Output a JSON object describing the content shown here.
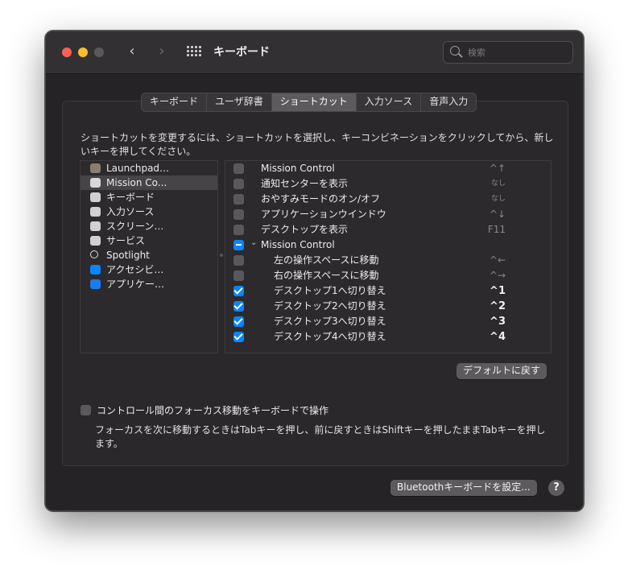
{
  "window": {
    "title": "キーボード"
  },
  "search": {
    "placeholder": "検索"
  },
  "tabs": [
    {
      "label": "キーボード",
      "active": false
    },
    {
      "label": "ユーザ辞書",
      "active": false
    },
    {
      "label": "ショートカット",
      "active": true
    },
    {
      "label": "入力ソース",
      "active": false
    },
    {
      "label": "音声入力",
      "active": false
    }
  ],
  "description": "ショートカットを変更するには、ショートカットを選択し、キーコンビネーションをクリックしてから、新しいキーを押してください。",
  "categories": [
    {
      "label": "Launchpad…",
      "icon": "launchpad-icon",
      "color": "#8a7f6e",
      "selected": false
    },
    {
      "label": "Mission Co...",
      "icon": "mission-control-icon",
      "color": "#d8d8d8",
      "selected": true
    },
    {
      "label": "キーボード",
      "icon": "keyboard-icon",
      "color": "#d0d0d0",
      "selected": false
    },
    {
      "label": "入力ソース",
      "icon": "input-source-icon",
      "color": "#d0d0d0",
      "selected": false
    },
    {
      "label": "スクリーン…",
      "icon": "screenshot-icon",
      "color": "#d0d0d0",
      "selected": false
    },
    {
      "label": "サービス",
      "icon": "gear-icon",
      "color": "#d0d0d0",
      "selected": false
    },
    {
      "label": "Spotlight",
      "icon": "spotlight-icon",
      "color": "#2c2a2d",
      "selected": false
    },
    {
      "label": "アクセシビ…",
      "icon": "accessibility-icon",
      "color": "#0a84ff",
      "selected": false
    },
    {
      "label": "アプリケー…",
      "icon": "app-store-icon",
      "color": "#1a7cf0",
      "selected": false
    }
  ],
  "shortcuts": [
    {
      "label": "Mission Control",
      "key": "^↑",
      "state": "off",
      "indent": 0,
      "key_style": "dim"
    },
    {
      "label": "通知センターを表示",
      "key": "なし",
      "state": "off",
      "indent": 0,
      "key_style": "small"
    },
    {
      "label": "おやすみモードのオン/オフ",
      "key": "なし",
      "state": "off",
      "indent": 0,
      "key_style": "small"
    },
    {
      "label": "アプリケーションウインドウ",
      "key": "^↓",
      "state": "off",
      "indent": 0,
      "key_style": "dim"
    },
    {
      "label": "デスクトップを表示",
      "key": "F11",
      "state": "off",
      "indent": 0,
      "key_style": "dim"
    },
    {
      "label": "Mission Control",
      "key": "",
      "state": "mixed",
      "indent": 0,
      "group": true,
      "key_style": "dim"
    },
    {
      "label": "左の操作スペースに移動",
      "key": "^←",
      "state": "off",
      "indent": 1,
      "key_style": "dim"
    },
    {
      "label": "右の操作スペースに移動",
      "key": "^→",
      "state": "off",
      "indent": 1,
      "key_style": "dim"
    },
    {
      "label": "デスクトップ1へ切り替え",
      "key": "^1",
      "state": "on",
      "indent": 1,
      "key_style": "bold"
    },
    {
      "label": "デスクトップ2へ切り替え",
      "key": "^2",
      "state": "on",
      "indent": 1,
      "key_style": "bold"
    },
    {
      "label": "デスクトップ3へ切り替え",
      "key": "^3",
      "state": "on",
      "indent": 1,
      "key_style": "bold"
    },
    {
      "label": "デスクトップ4へ切り替え",
      "key": "^4",
      "state": "on",
      "indent": 1,
      "key_style": "bold"
    }
  ],
  "buttons": {
    "restore_defaults": "デフォルトに戻す",
    "bluetooth": "Bluetoothキーボードを設定...",
    "help": "?"
  },
  "focus_option": {
    "label": "コントロール間のフォーカス移動をキーボードで操作",
    "description": "フォーカスを次に移動するときはTabキーを押し、前に戻すときはShiftキーを押したままTabキーを押します。",
    "checked": false
  },
  "colors": {
    "accent": "#0a84ff",
    "close": "#fe5f57",
    "minimize": "#febc2e"
  }
}
